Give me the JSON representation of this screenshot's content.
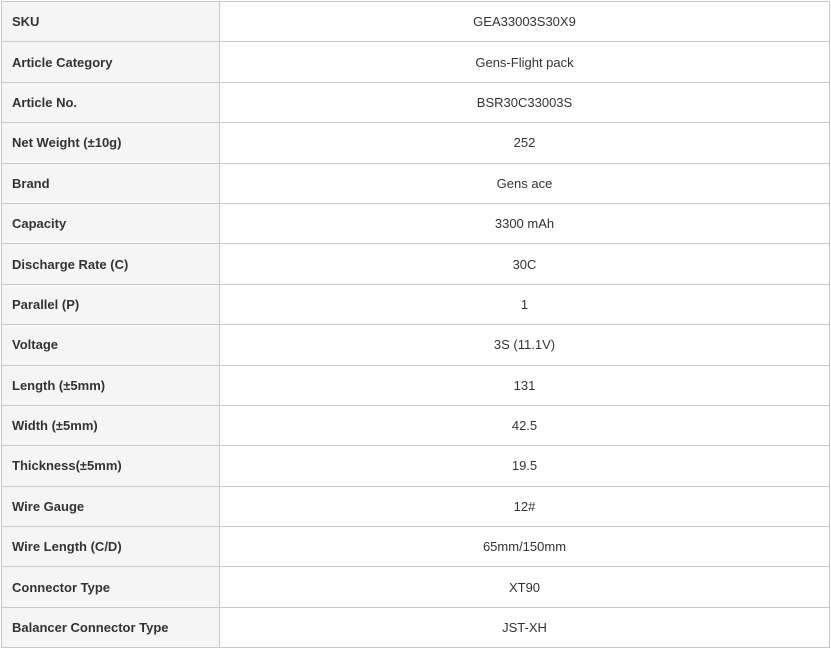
{
  "specs": [
    {
      "label": "SKU",
      "value": "GEA33003S30X9"
    },
    {
      "label": "Article Category",
      "value": "Gens-Flight pack"
    },
    {
      "label": "Article No.",
      "value": "BSR30C33003S"
    },
    {
      "label": "Net Weight (±10g)",
      "value": "252"
    },
    {
      "label": "Brand",
      "value": "Gens ace"
    },
    {
      "label": "Capacity",
      "value": "3300 mAh"
    },
    {
      "label": "Discharge Rate (C)",
      "value": "30C"
    },
    {
      "label": "Parallel (P)",
      "value": "1"
    },
    {
      "label": "Voltage",
      "value": "3S (11.1V)"
    },
    {
      "label": "Length (±5mm)",
      "value": "131"
    },
    {
      "label": "Width (±5mm)",
      "value": "42.5"
    },
    {
      "label": "Thickness(±5mm)",
      "value": "19.5"
    },
    {
      "label": "Wire Gauge",
      "value": "12#"
    },
    {
      "label": "Wire Length (C/D)",
      "value": "65mm/150mm"
    },
    {
      "label": "Connector Type",
      "value": "XT90"
    },
    {
      "label": "Balancer Connector Type",
      "value": "JST-XH"
    }
  ]
}
